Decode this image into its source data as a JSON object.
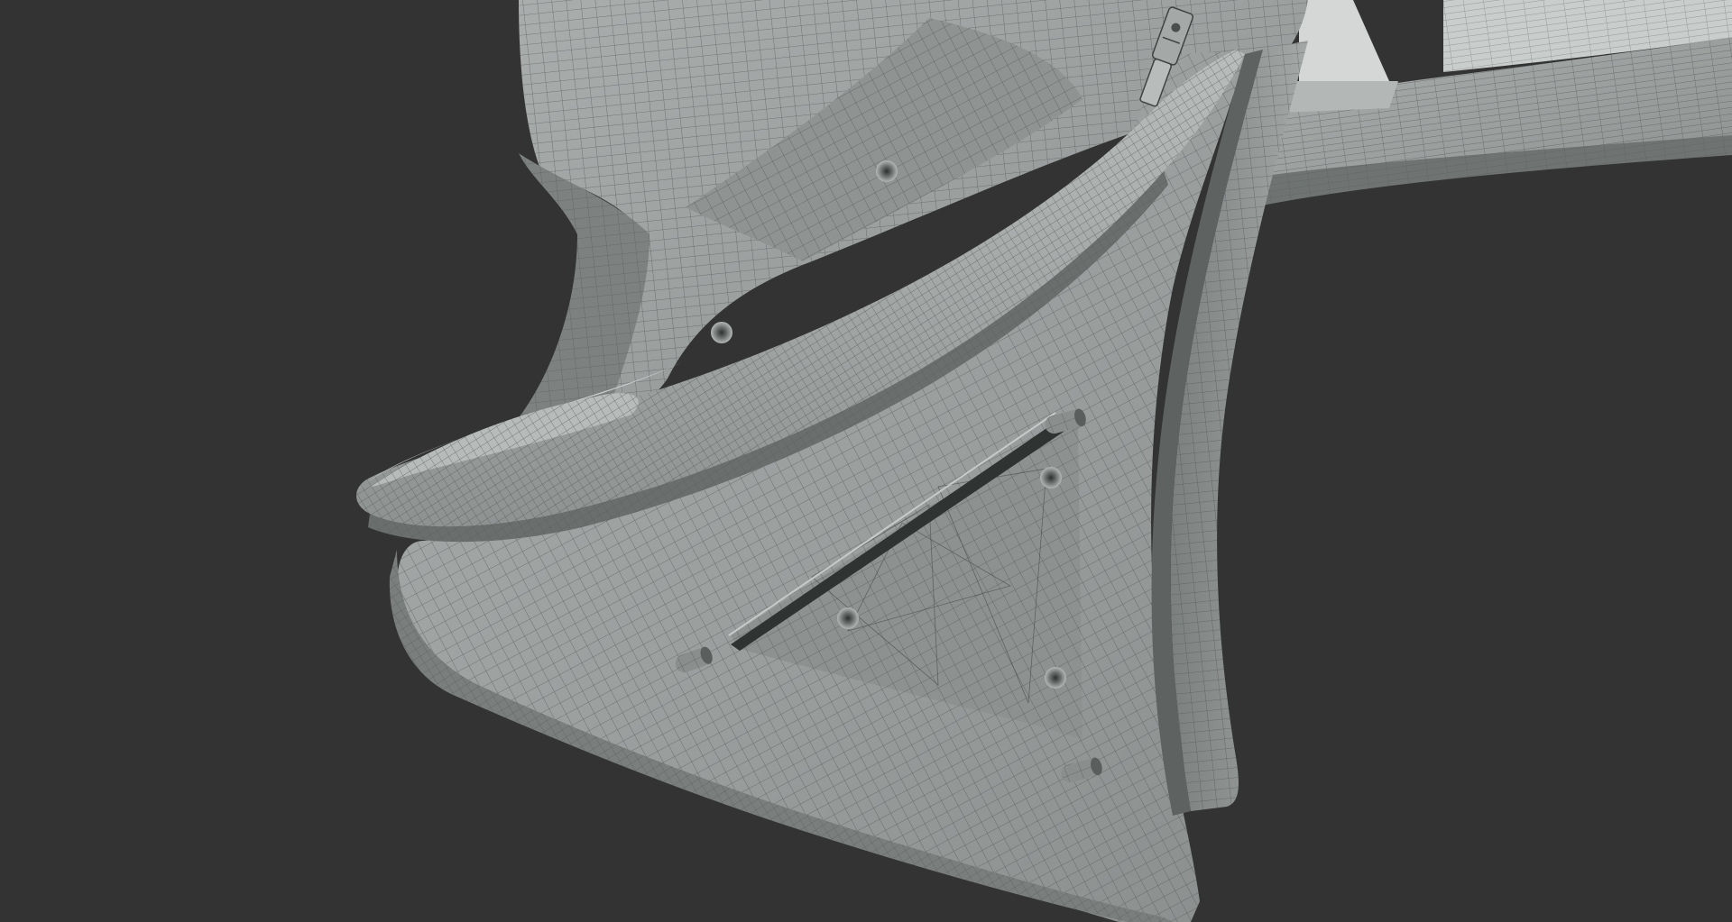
{
  "viewport": {
    "background": "#333333",
    "render_mode": "wireframe-on-shaded",
    "surface_color": "#9ea2a1",
    "surface_shadow_color": "#7d8281",
    "surface_highlight_color": "#c4c8c7",
    "wire_color": "#4a4f4e",
    "subject": "3d-mesh-wing-endplate",
    "visible_text": []
  }
}
